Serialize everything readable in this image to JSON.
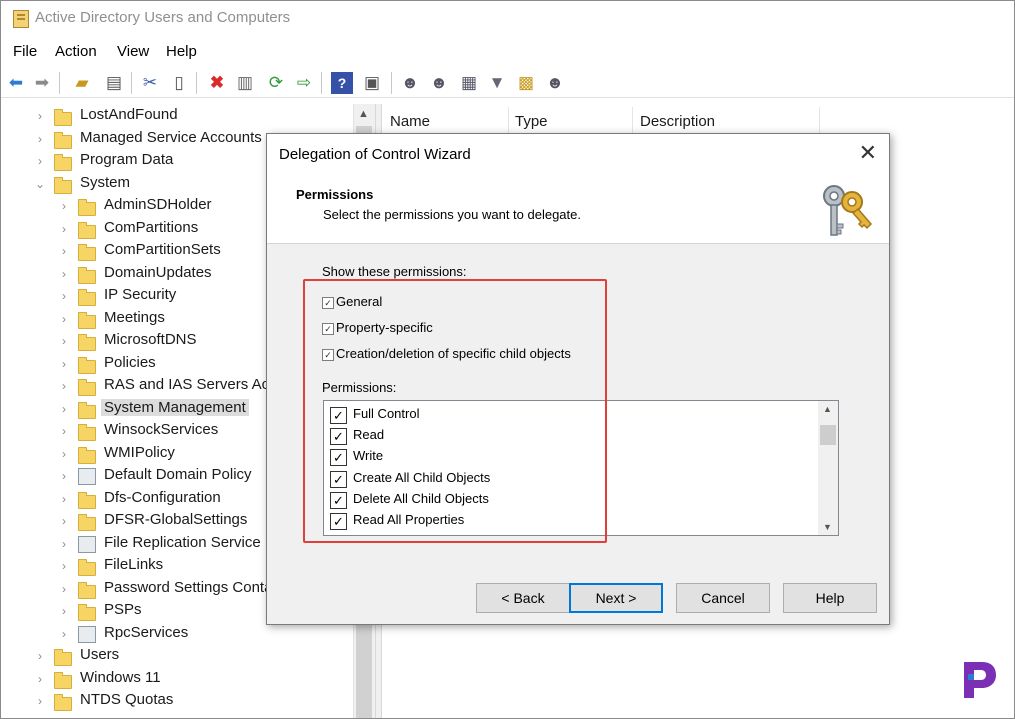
{
  "window": {
    "title": "Active Directory Users and Computers"
  },
  "menu": [
    "File",
    "Action",
    "View",
    "Help"
  ],
  "toolbar": {
    "buttons": [
      "back-icon",
      "forward-icon",
      "up-folder-icon",
      "show-tree-icon",
      "cut-icon",
      "copy-icon",
      "delete-icon",
      "properties-icon",
      "refresh-icon",
      "export-icon",
      "help-icon",
      "console-icon",
      "add-user-icon",
      "add-group-icon",
      "add-ou-icon",
      "filter-icon",
      "find-icon",
      "add-to-group-icon"
    ]
  },
  "tree": [
    {
      "label": "LostAndFound",
      "level": 1,
      "expanded": false,
      "icon": "folder"
    },
    {
      "label": "Managed Service Accounts",
      "level": 1,
      "expanded": false,
      "icon": "folder"
    },
    {
      "label": "Program Data",
      "level": 1,
      "expanded": false,
      "icon": "folder"
    },
    {
      "label": "System",
      "level": 1,
      "expanded": true,
      "icon": "folder"
    },
    {
      "label": "AdminSDHolder",
      "level": 2,
      "expanded": false,
      "icon": "folder"
    },
    {
      "label": "ComPartitions",
      "level": 2,
      "expanded": false,
      "icon": "folder"
    },
    {
      "label": "ComPartitionSets",
      "level": 2,
      "expanded": false,
      "icon": "folder"
    },
    {
      "label": "DomainUpdates",
      "level": 2,
      "expanded": false,
      "icon": "folder"
    },
    {
      "label": "IP Security",
      "level": 2,
      "expanded": false,
      "icon": "folder"
    },
    {
      "label": "Meetings",
      "level": 2,
      "expanded": false,
      "icon": "folder"
    },
    {
      "label": "MicrosoftDNS",
      "level": 2,
      "expanded": false,
      "icon": "folder"
    },
    {
      "label": "Policies",
      "level": 2,
      "expanded": false,
      "icon": "folder"
    },
    {
      "label": "RAS and IAS Servers Acces",
      "level": 2,
      "expanded": false,
      "icon": "folder"
    },
    {
      "label": "System Management",
      "level": 2,
      "expanded": false,
      "icon": "folder",
      "selected": true
    },
    {
      "label": "WinsockServices",
      "level": 2,
      "expanded": false,
      "icon": "folder"
    },
    {
      "label": "WMIPolicy",
      "level": 2,
      "expanded": false,
      "icon": "folder"
    },
    {
      "label": "Default Domain Policy",
      "level": 2,
      "expanded": false,
      "icon": "policy"
    },
    {
      "label": "Dfs-Configuration",
      "level": 2,
      "expanded": false,
      "icon": "folder"
    },
    {
      "label": "DFSR-GlobalSettings",
      "level": 2,
      "expanded": false,
      "icon": "folder"
    },
    {
      "label": "File Replication Service",
      "level": 2,
      "expanded": false,
      "icon": "service"
    },
    {
      "label": "FileLinks",
      "level": 2,
      "expanded": false,
      "icon": "folder"
    },
    {
      "label": "Password Settings Contai",
      "level": 2,
      "expanded": false,
      "icon": "folder"
    },
    {
      "label": "PSPs",
      "level": 2,
      "expanded": false,
      "icon": "folder"
    },
    {
      "label": "RpcServices",
      "level": 2,
      "expanded": false,
      "icon": "rpc"
    },
    {
      "label": "Users",
      "level": 1,
      "expanded": false,
      "icon": "folder"
    },
    {
      "label": "Windows 11",
      "level": 1,
      "expanded": false,
      "icon": "folder"
    },
    {
      "label": "NTDS Quotas",
      "level": 1,
      "expanded": false,
      "icon": "folder"
    }
  ],
  "list_columns": [
    "Name",
    "Type",
    "Description"
  ],
  "dialog": {
    "title": "Delegation of Control Wizard",
    "close": "✕",
    "heading": "Permissions",
    "subheading": "Select the permissions you want to delegate.",
    "show_label": "Show these permissions:",
    "filters": [
      {
        "label": "General",
        "checked": true
      },
      {
        "label": "Property-specific",
        "checked": true
      },
      {
        "label": "Creation/deletion of specific child objects",
        "checked": true
      }
    ],
    "permissions_label": "Permissions:",
    "permissions": [
      {
        "label": "Full Control",
        "checked": true
      },
      {
        "label": "Read",
        "checked": true
      },
      {
        "label": "Write",
        "checked": true
      },
      {
        "label": "Create All Child Objects",
        "checked": true
      },
      {
        "label": "Delete All Child Objects",
        "checked": true
      },
      {
        "label": "Read All Properties",
        "checked": true
      }
    ],
    "buttons": {
      "back": "< Back",
      "next": "Next >",
      "cancel": "Cancel",
      "help": "Help"
    }
  },
  "colors": {
    "highlight": "#e0403a",
    "accent": "#0078d7",
    "logo": "#7a2fb5"
  }
}
